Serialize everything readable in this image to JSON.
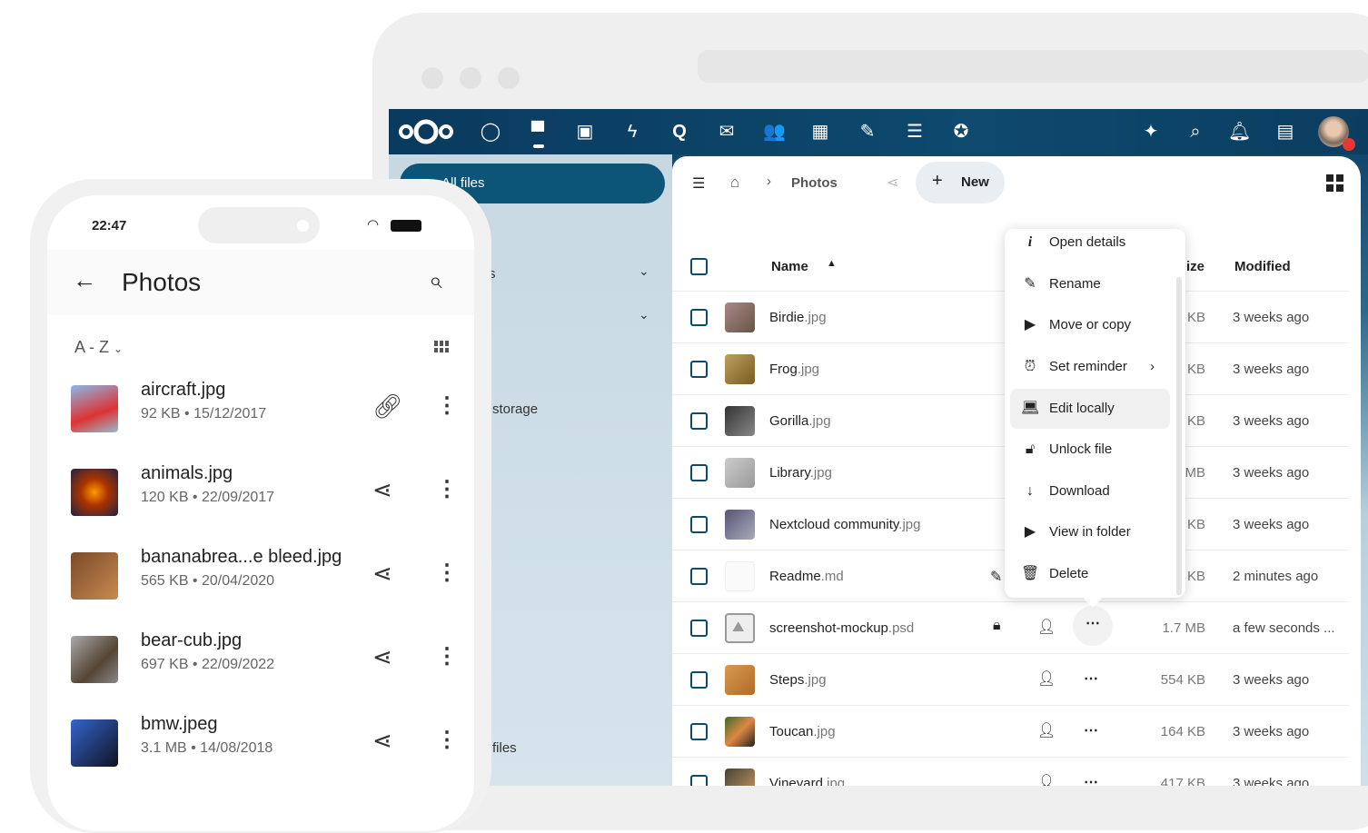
{
  "colors": {
    "header": "#0b3d63",
    "primary": "#0c5478",
    "highlight": "#f0f0f0"
  },
  "desktop": {
    "topbar": {
      "apps": [
        "dashboard-icon",
        "files-icon",
        "photos-icon",
        "activity-icon",
        "talk-icon",
        "mail-icon",
        "contacts-icon",
        "calendar-icon",
        "notes-icon",
        "deck-icon",
        "cospend-icon"
      ],
      "right": [
        "assistant-icon",
        "search-icon",
        "notifications-icon",
        "contacts-menu-icon",
        "avatar"
      ]
    },
    "nav": {
      "all_files": "All files",
      "partial_storage": "storage",
      "partial_files": "files",
      "partial_s": "s"
    },
    "breadcrumb": {
      "current": "Photos"
    },
    "new_label": "New",
    "columns": {
      "name": "Name",
      "size": "ize",
      "modified": "Modified"
    },
    "files": [
      {
        "name": "Birdie",
        "ext": ".jpg",
        "size": "KB",
        "modified": "3 weeks ago"
      },
      {
        "name": "Frog",
        "ext": ".jpg",
        "size": "KB",
        "modified": "3 weeks ago"
      },
      {
        "name": "Gorilla",
        "ext": ".jpg",
        "size": "KB",
        "modified": "3 weeks ago"
      },
      {
        "name": "Library",
        "ext": ".jpg",
        "size": "MB",
        "modified": "3 weeks ago"
      },
      {
        "name": "Nextcloud community",
        "ext": ".jpg",
        "size": "KB",
        "modified": "3 weeks ago"
      },
      {
        "name": "Readme",
        "ext": ".md",
        "size": "KB",
        "modified": "2 minutes ago"
      },
      {
        "name": "screenshot-mockup",
        "ext": ".psd",
        "size": "1.7 MB",
        "modified": "a few seconds ..."
      },
      {
        "name": "Steps",
        "ext": ".jpg",
        "size": "554 KB",
        "modified": "3 weeks ago"
      },
      {
        "name": "Toucan",
        "ext": ".jpg",
        "size": "164 KB",
        "modified": "3 weeks ago"
      },
      {
        "name": "Vineyard",
        "ext": ".jpg",
        "size": "417 KB",
        "modified": "3 weeks ago"
      }
    ],
    "menu": [
      {
        "label": "Open details",
        "icon": "info-icon"
      },
      {
        "label": "Rename",
        "icon": "pencil-icon"
      },
      {
        "label": "Move or copy",
        "icon": "folder-move-icon"
      },
      {
        "label": "Set reminder",
        "icon": "alarm-icon"
      },
      {
        "label": "Edit locally",
        "icon": "laptop-icon"
      },
      {
        "label": "Unlock file",
        "icon": "unlock-icon"
      },
      {
        "label": "Download",
        "icon": "download-icon"
      },
      {
        "label": "View in folder",
        "icon": "folder-icon"
      },
      {
        "label": "Delete",
        "icon": "trash-icon"
      }
    ]
  },
  "phone": {
    "time": "22:47",
    "title": "Photos",
    "sort": "A - Z",
    "files": [
      {
        "name": "aircraft.jpg",
        "meta": "92 KB • 15/12/2017",
        "action": "link-icon"
      },
      {
        "name": "animals.jpg",
        "meta": "120 KB • 22/09/2017",
        "action": "share-icon"
      },
      {
        "name": "bananabrea...e bleed.jpg",
        "meta": "565 KB • 20/04/2020",
        "action": "share-icon"
      },
      {
        "name": "bear-cub.jpg",
        "meta": "697 KB • 22/09/2022",
        "action": "share-icon"
      },
      {
        "name": "bmw.jpeg",
        "meta": "3.1 MB • 14/08/2018",
        "action": "share-icon"
      }
    ]
  }
}
